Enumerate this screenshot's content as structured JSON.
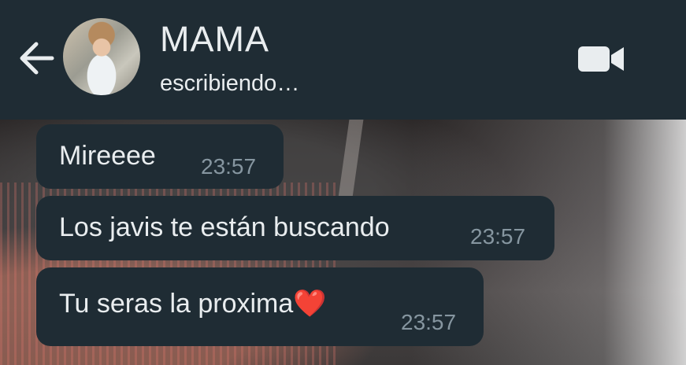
{
  "header": {
    "back_icon": "arrow-left-icon",
    "title": "MAMA",
    "status": "escribiendo…",
    "video_icon": "video-camera-icon",
    "background_color": "#1f2c34"
  },
  "messages": [
    {
      "text": "Mireeee",
      "time": "23:57"
    },
    {
      "text": "Los javis te están buscando",
      "time": "23:57"
    },
    {
      "text": "Tu seras la proxima❤️",
      "time": "23:57"
    }
  ],
  "colors": {
    "bubble": "#1f2c34",
    "text": "#e9edef",
    "timestamp": "#8696a0"
  }
}
